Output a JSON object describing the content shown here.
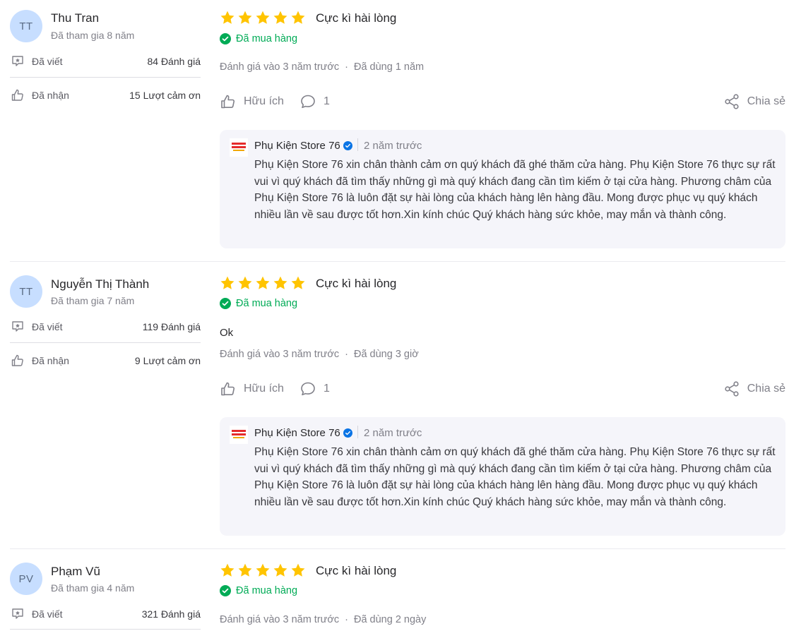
{
  "reviews": [
    {
      "avatar_initials": "TT",
      "name": "Thu Tran",
      "joined": "Đã tham gia 8 năm",
      "written_label": "Đã viết",
      "written_value": "84 Đánh giá",
      "received_label": "Đã nhận",
      "received_value": "15 Lượt cảm ơn",
      "rating": 5,
      "title": "Cực kì hài lòng",
      "purchased": "Đã mua hàng",
      "content": "",
      "reviewed_at": "Đánh giá vào 3 năm trước",
      "used_for": "Đã dùng 1 năm",
      "helpful_label": "Hữu ích",
      "comment_count": "1",
      "share_label": "Chia sẻ",
      "reply": {
        "shop_name": "Phụ Kiện Store 76",
        "time": "2 năm trước",
        "text": "Phụ Kiện Store 76 xin chân thành cảm ơn quý khách đã ghé thăm cửa hàng. Phụ Kiện Store 76 thực sự rất vui vì quý khách đã tìm thấy những gì mà quý khách đang cần tìm kiếm ở tại cửa hàng. Phương châm của Phụ Kiện Store 76 là luôn đặt sự hài lòng của khách hàng lên hàng đầu. Mong được phục vụ quý khách nhiều lần về sau được tốt hơn.Xin kính chúc Quý khách hàng sức khỏe, may mắn và thành công."
      }
    },
    {
      "avatar_initials": "TT",
      "name": "Nguyễn Thị Thành",
      "joined": "Đã tham gia 7 năm",
      "written_label": "Đã viết",
      "written_value": "119 Đánh giá",
      "received_label": "Đã nhận",
      "received_value": "9 Lượt cảm ơn",
      "rating": 5,
      "title": "Cực kì hài lòng",
      "purchased": "Đã mua hàng",
      "content": "Ok",
      "reviewed_at": "Đánh giá vào 3 năm trước",
      "used_for": "Đã dùng 3 giờ",
      "helpful_label": "Hữu ích",
      "comment_count": "1",
      "share_label": "Chia sẻ",
      "reply": {
        "shop_name": "Phụ Kiện Store 76",
        "time": "2 năm trước",
        "text": "Phụ Kiện Store 76 xin chân thành cảm ơn quý khách đã ghé thăm cửa hàng. Phụ Kiện Store 76 thực sự rất vui vì quý khách đã tìm thấy những gì mà quý khách đang cần tìm kiếm ở tại cửa hàng. Phương châm của Phụ Kiện Store 76 là luôn đặt sự hài lòng của khách hàng lên hàng đầu. Mong được phục vụ quý khách nhiều lần về sau được tốt hơn.Xin kính chúc Quý khách hàng sức khỏe, may mắn và thành công."
      }
    },
    {
      "avatar_initials": "PV",
      "name": "Phạm Vũ",
      "joined": "Đã tham gia 4 năm",
      "written_label": "Đã viết",
      "written_value": "321 Đánh giá",
      "rating": 5,
      "title": "Cực kì hài lòng",
      "purchased": "Đã mua hàng",
      "reviewed_at": "Đánh giá vào 3 năm trước",
      "used_for": "Đã dùng 2 ngày"
    }
  ],
  "colors": {
    "star": "#ffc400",
    "purchased": "#00ab56",
    "verified": "#0b74e5",
    "avatar_bg": "#c7deff"
  },
  "icons": {
    "written": "review-bubble-icon",
    "received": "thumbs-up-icon",
    "helpful": "thumbs-up-icon",
    "comment": "comment-bubble-icon",
    "share": "share-icon",
    "purchased": "check-circle-icon",
    "verified": "verified-badge-icon"
  }
}
